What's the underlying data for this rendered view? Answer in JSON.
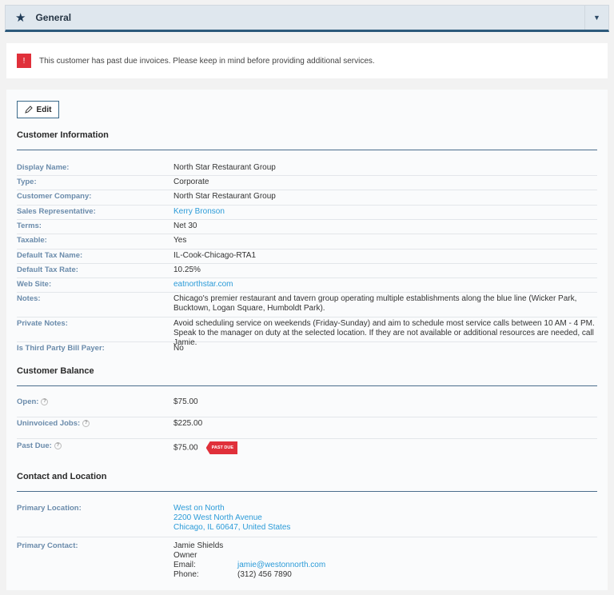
{
  "header": {
    "title": "General",
    "icon": "star-icon",
    "toggle_icon": "caret-down-icon"
  },
  "alert": {
    "icon": "!",
    "message": "This customer has past due invoices. Please keep in mind before providing additional services."
  },
  "edit_label": "Edit",
  "customer_info": {
    "title": "Customer Information",
    "rows": [
      {
        "label": "Display Name:",
        "value": "North Star Restaurant Group"
      },
      {
        "label": "Type:",
        "value": "Corporate"
      },
      {
        "label": "Customer Company:",
        "value": "North Star Restaurant Group"
      },
      {
        "label": "Sales Representative:",
        "value": "Kerry Bronson",
        "link": true
      },
      {
        "label": "Terms:",
        "value": "Net 30"
      },
      {
        "label": "Taxable:",
        "value": "Yes"
      },
      {
        "label": "Default Tax Name:",
        "value": "IL-Cook-Chicago-RTA1"
      },
      {
        "label": "Default Tax Rate:",
        "value": "10.25%"
      },
      {
        "label": "Web Site:",
        "value": "eatnorthstar.com",
        "link": true
      },
      {
        "label": "Notes:",
        "value": "Chicago's premier restaurant and tavern group operating multiple establishments along the blue line (Wicker Park, Bucktown, Logan Square, Humboldt Park)."
      },
      {
        "label": "Private Notes:",
        "value": "Avoid scheduling service on weekends (Friday-Sunday) and aim to schedule most service calls between 10 AM - 4 PM. Speak to the manager on duty at the selected location. If they are not available or additional resources are needed, call Jamie."
      },
      {
        "label": "Is Third Party Bill Payer:",
        "value": "No"
      }
    ]
  },
  "balance": {
    "title": "Customer Balance",
    "rows": [
      {
        "label": "Open:",
        "value": "$75.00"
      },
      {
        "label": "Uninvoiced Jobs:",
        "value": "$225.00"
      },
      {
        "label": "Past Due:",
        "value": "$75.00",
        "badge": "PAST DUE"
      }
    ]
  },
  "contact": {
    "title": "Contact and Location",
    "location": {
      "label": "Primary Location:",
      "name": "West on North",
      "street": "2200 West North Avenue",
      "city": "Chicago, IL 60647, United States"
    },
    "primary": {
      "label": "Primary Contact:",
      "name": "Jamie Shields",
      "role": "Owner",
      "email_label": "Email:",
      "email": "jamie@westonnorth.com",
      "phone_label": "Phone:",
      "phone": "(312) 456 7890"
    }
  },
  "colors": {
    "accent": "#2d5a7b",
    "link": "#2b9bd8",
    "danger": "#e0303a",
    "label": "#6a8bab"
  }
}
